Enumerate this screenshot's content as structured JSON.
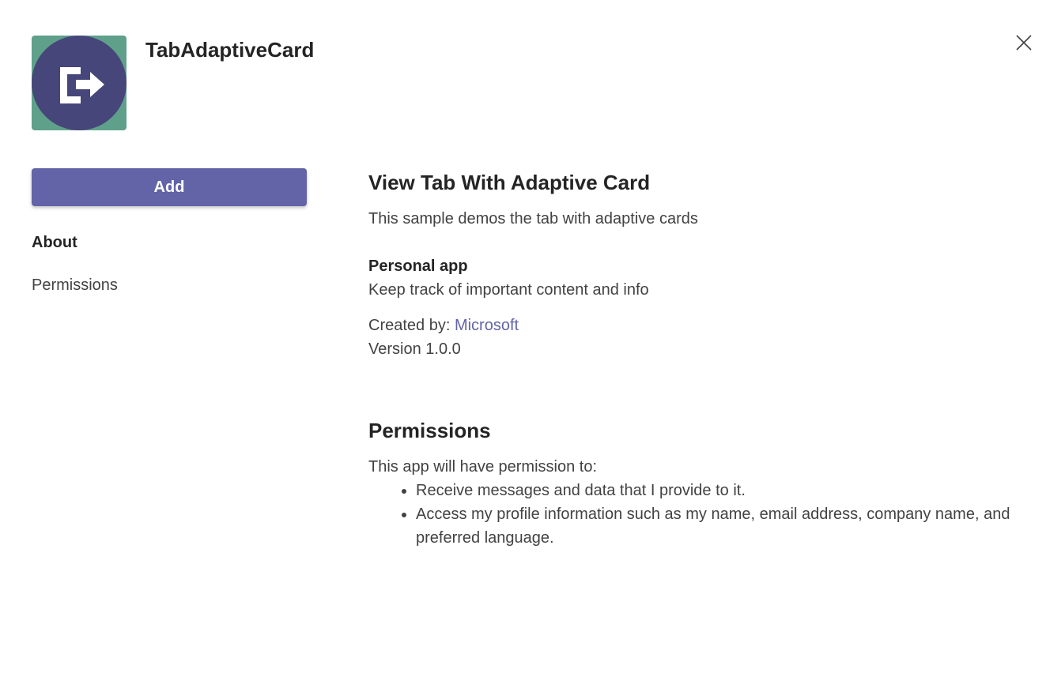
{
  "app": {
    "name": "TabAdaptiveCard",
    "icon": "sign-out-arrow-icon",
    "icon_colors": {
      "background": "#5fa08a",
      "circle": "#46467a",
      "glyph": "#ffffff"
    }
  },
  "actions": {
    "add_label": "Add",
    "close_icon": "close-icon"
  },
  "nav": {
    "items": [
      {
        "label": "About",
        "active": true
      },
      {
        "label": "Permissions",
        "active": false
      }
    ]
  },
  "about": {
    "title": "View Tab With Adaptive Card",
    "description": "This sample demos the tab with adaptive cards",
    "capability": {
      "title": "Personal app",
      "description": "Keep track of important content and info"
    },
    "created_by_label": "Created by:",
    "publisher": "Microsoft",
    "version": "Version 1.0.0"
  },
  "permissions": {
    "title": "Permissions",
    "intro": "This app will have permission to:",
    "items": [
      "Receive messages and data that I provide to it.",
      "Access my profile information such as my name, email address, company name, and preferred language."
    ]
  },
  "colors": {
    "accent": "#6264a7",
    "text_primary": "#242424",
    "text_secondary": "#424242"
  }
}
